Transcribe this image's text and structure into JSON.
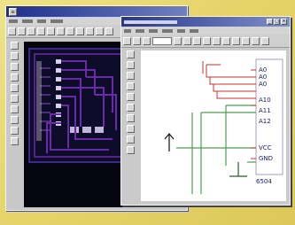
{
  "schematic": {
    "chip_pins": [
      "A0",
      "A0",
      "A0",
      "A10",
      "A11",
      "A12",
      "VCC",
      "GND"
    ],
    "chip_name": "6504"
  },
  "colors": {
    "desktop": "#e8d870",
    "title_bar": "#1e2f8a",
    "pcb_background": "#050510",
    "pcb_trace": "#6a2aa8",
    "pcb_pad": "#d8d0e8",
    "schematic_background": "#ffffff",
    "wire_red": "#c83030",
    "wire_green": "#4aa04a",
    "pin_label": "#1a1a66"
  },
  "icons": {
    "pcb_window": [
      "close-icon",
      "tool-icon"
    ],
    "schematic_window": [
      "minimize-icon",
      "maximize-icon",
      "close-icon",
      "pointer-arrow-icon"
    ]
  }
}
